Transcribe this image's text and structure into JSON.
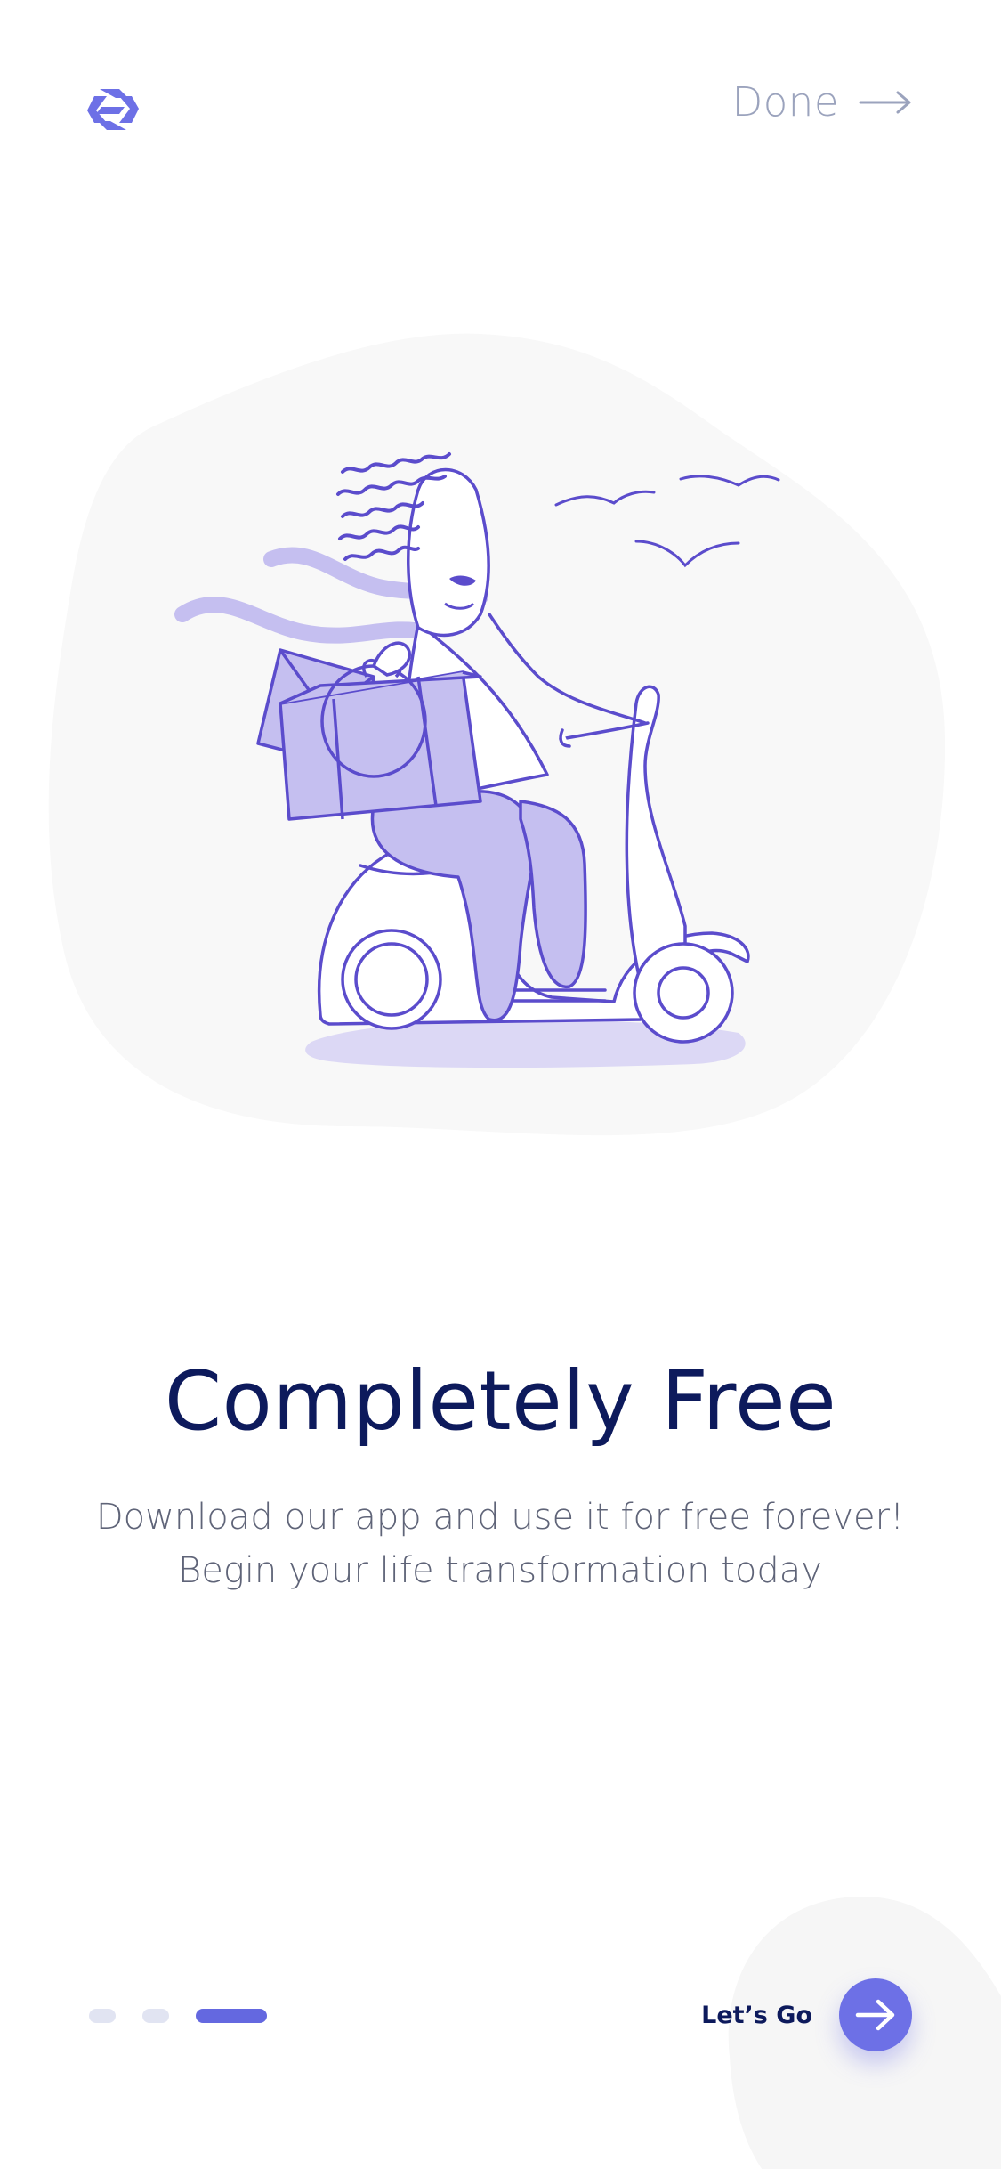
{
  "header": {
    "done_label": "Done"
  },
  "icons": {
    "logo": "brand-logo-icon",
    "done_arrow": "arrow-right-icon",
    "cta_arrow": "arrow-right-icon"
  },
  "content": {
    "title": "Completely Free",
    "subtitle_line1": "Download our app and use it for free forever!",
    "subtitle_line2": "Begin your life transformation today"
  },
  "pager": {
    "total": 3,
    "active_index": 2
  },
  "footer": {
    "cta_label": "Let’s Go"
  },
  "colors": {
    "accent": "#6d70e6",
    "title": "#0d1a5c",
    "illustration_line": "#5b4ccc",
    "illustration_fill": "#c5bff0",
    "blob": "#f8f8f8"
  }
}
